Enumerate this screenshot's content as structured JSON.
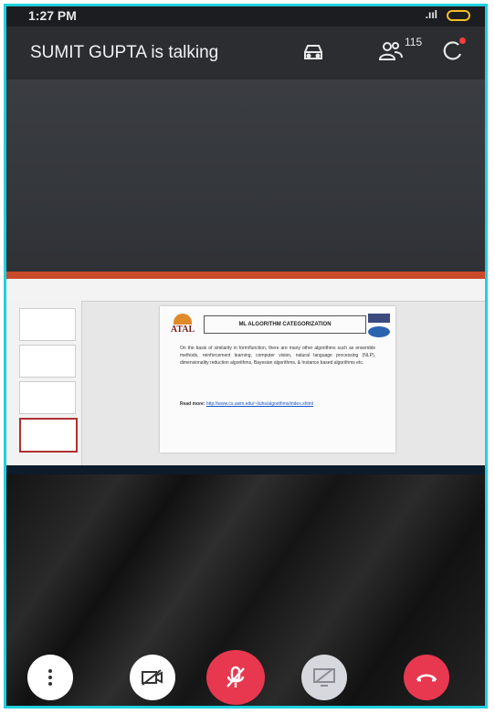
{
  "status_bar": {
    "time": "1:27 PM",
    "signal": ".ııl"
  },
  "header": {
    "talking_label": "SUMIT  GUPTA is talking",
    "participant_count": "115",
    "icons": [
      "car-icon",
      "participants-icon",
      "refresh-icon"
    ]
  },
  "shared_slide": {
    "title": "ML ALGORITHM CATEGORIZATION",
    "logo_text": "ATAL",
    "body": "On the basis of similarity in form/function, there are many other algorithms such as ensemble methods, reinforcement learning, computer vision, natural language processing (NLP), dimensionality reduction algorithms, Bayesian algorithms, & Instance based algorithms etc.",
    "read_more_label": "Read more:",
    "read_more_link": "http://www.cs.uwm.edu/~tiuhs/algorithms/index.shtml"
  },
  "controls": [
    {
      "name": "more-options",
      "icon": "more-vertical-icon"
    },
    {
      "name": "video-off",
      "icon": "video-off-icon"
    },
    {
      "name": "mute",
      "icon": "mic-off-icon"
    },
    {
      "name": "share-screen",
      "icon": "screen-share-off-icon"
    },
    {
      "name": "end-call",
      "icon": "phone-hangup-icon"
    }
  ],
  "colors": {
    "accent_red": "#e8384f",
    "frame_border": "#1fd0e0"
  }
}
